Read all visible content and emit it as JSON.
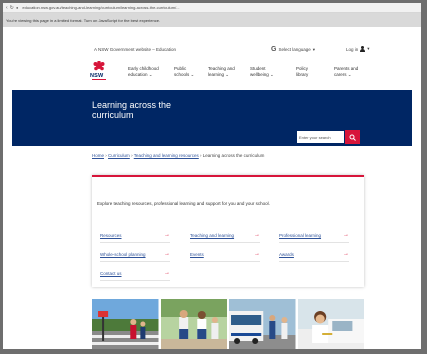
{
  "browser": {
    "url": "education.nsw.gov.au/teaching-and-learning/curriculum/learning-across-the-curriculum/..."
  },
  "notice": {
    "text": "You're viewing this page in a limited format. Turn on JavaScript for the best experience."
  },
  "util": {
    "gov_text": "A NSW Government website – Education",
    "language_label": "Select language",
    "login_label": "Log in"
  },
  "nav": {
    "items": [
      {
        "line1": "Early childhood",
        "line2": "education ⌄"
      },
      {
        "line1": "Public",
        "line2": "schools ⌄"
      },
      {
        "line1": "Teaching and",
        "line2": "learning ⌄"
      },
      {
        "line1": "Student",
        "line2": "wellbeing ⌄"
      },
      {
        "line1": "Policy",
        "line2": "library"
      },
      {
        "line1": "Parents and",
        "line2": "carers ⌄"
      }
    ],
    "logo_text": "NSW"
  },
  "banner": {
    "title": "Learning across the curriculum",
    "search_placeholder": "Enter your search"
  },
  "breadcrumb": {
    "home": "Home",
    "c1": "Curriculum",
    "c2": "Teaching and learning resources",
    "current": "Learning across the curriculum"
  },
  "card": {
    "intro": "Explore teaching resources, professional learning and support for you and your school.",
    "links": [
      {
        "label": "Resources"
      },
      {
        "label": "Teaching and learning"
      },
      {
        "label": "Professional learning"
      },
      {
        "label": "Whole-school planning"
      },
      {
        "label": "Events"
      },
      {
        "label": "Awards"
      },
      {
        "label": "Contact us"
      }
    ]
  },
  "colors": {
    "primary": "#002664",
    "accent": "#d7153a",
    "link": "#2e5299"
  }
}
